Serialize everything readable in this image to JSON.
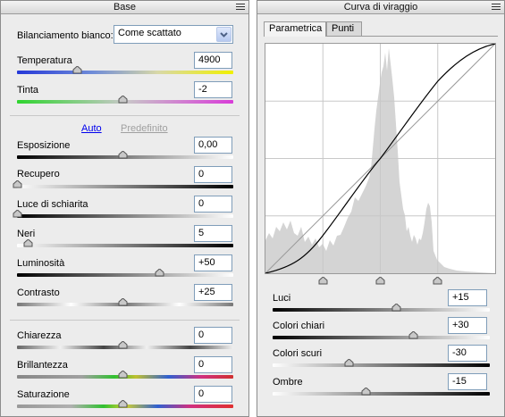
{
  "left_panel": {
    "title": "Base",
    "white_balance": {
      "label": "Bilanciamento bianco:",
      "value": "Come scattato"
    },
    "temperature": {
      "label": "Temperatura",
      "value": "4900",
      "level": 0.28
    },
    "tint": {
      "label": "Tinta",
      "value": "-2",
      "level": 0.49
    },
    "auto_label": "Auto",
    "default_label": "Predefinito",
    "tone_sliders": [
      {
        "label": "Esposizione",
        "value": "0,00",
        "level": 0.49
      },
      {
        "label": "Recupero",
        "value": "0",
        "level": 0.0
      },
      {
        "label": "Luce di schiarita",
        "value": "0",
        "level": 0.0
      },
      {
        "label": "Neri",
        "value": "5",
        "level": 0.05
      },
      {
        "label": "Luminosità",
        "value": "+50",
        "level": 0.66
      },
      {
        "label": "Contrasto",
        "value": "+25",
        "level": 0.49
      }
    ],
    "presence_sliders": [
      {
        "label": "Chiarezza",
        "value": "0",
        "level": 0.49
      },
      {
        "label": "Brillantezza",
        "value": "0",
        "level": 0.49
      },
      {
        "label": "Saturazione",
        "value": "0",
        "level": 0.49
      }
    ]
  },
  "right_panel": {
    "title": "Curva di viraggio",
    "tabs": [
      "Parametrica",
      "Punti"
    ],
    "active_tab": "Parametrica",
    "region_sliders": [
      {
        "label": "Luci",
        "value": "+15",
        "level": 0.57
      },
      {
        "label": "Colori chiari",
        "value": "+30",
        "level": 0.65
      },
      {
        "label": "Colori scuri",
        "value": "-30",
        "level": 0.35
      },
      {
        "label": "Ombre",
        "value": "-15",
        "level": 0.43
      }
    ],
    "split_points": [
      0.25,
      0.5,
      0.75
    ]
  },
  "colors": {
    "panel_bg": "#ececec",
    "link": "#0000ee",
    "curve": "#000000",
    "histogram": "#d4d4d4",
    "grid": "#c8c8c8"
  }
}
